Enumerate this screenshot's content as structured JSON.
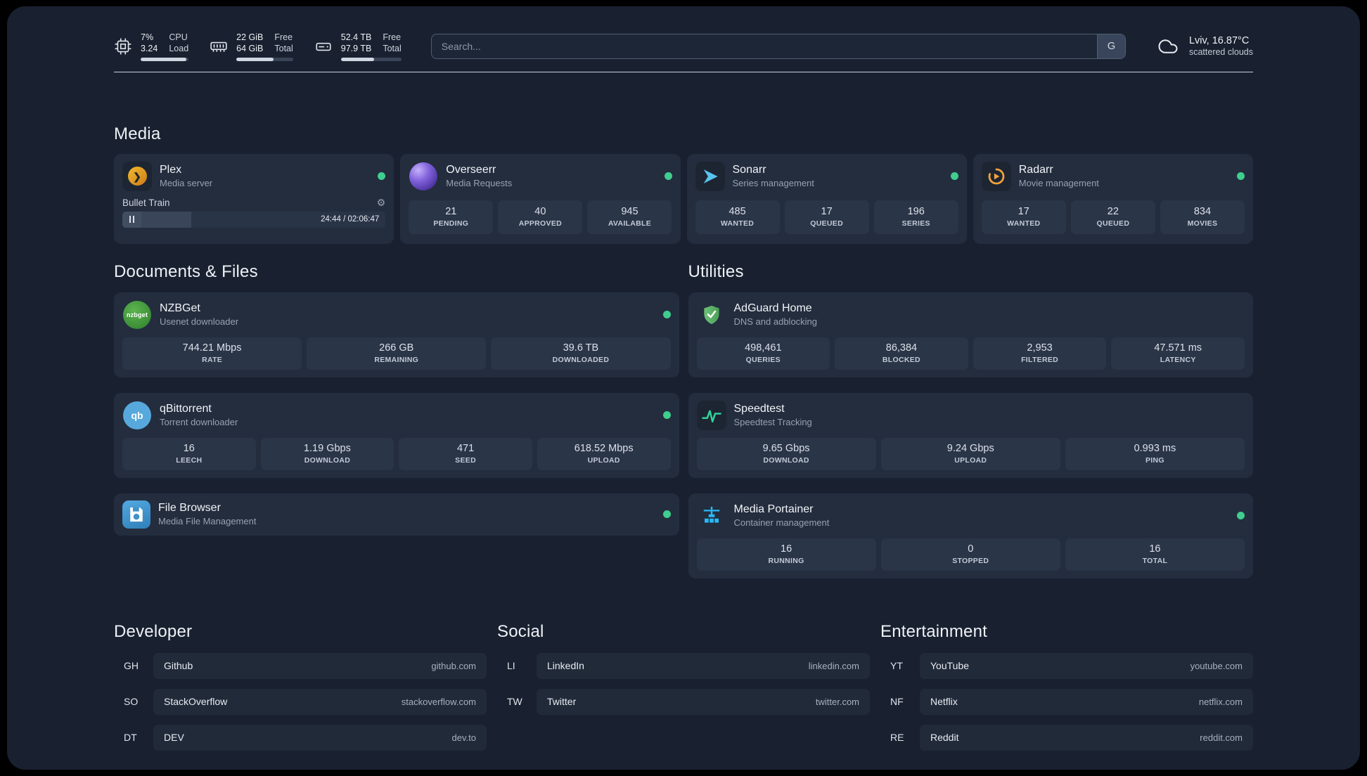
{
  "topbar": {
    "cpu": {
      "value_top": "7%",
      "value_bottom": "3.24",
      "label_top": "CPU",
      "label_bottom": "Load",
      "bar_percent": 95
    },
    "memory": {
      "value_top": "22 GiB",
      "value_bottom": "64 GiB",
      "label_top": "Free",
      "label_bottom": "Total",
      "bar_percent": 66
    },
    "disk": {
      "value_top": "52.4 TB",
      "value_bottom": "97.9 TB",
      "label_top": "Free",
      "label_bottom": "Total",
      "bar_percent": 55
    },
    "search": {
      "placeholder": "Search...",
      "button_label": "G"
    },
    "weather": {
      "location": "Lviv, 16.87°C",
      "condition": "scattered clouds"
    }
  },
  "icons": {
    "gear": "⚙",
    "plex_chevron": "❯",
    "nzbget_label": "nzbget",
    "qbittorrent_label": "qb"
  },
  "colors": {
    "status_online": "#3fce8e",
    "background": "#192130",
    "card": "#232d3e",
    "stat_tile": "#2b3548"
  },
  "groups": {
    "media": {
      "title": "Media",
      "plex": {
        "name": "Plex",
        "description": "Media server",
        "status": "online",
        "now_playing": {
          "title": "Bullet Train",
          "time": "24:44 / 02:06:47",
          "progress_percent": 19
        }
      },
      "overseerr": {
        "name": "Overseerr",
        "description": "Media Requests",
        "status": "online",
        "stats": [
          {
            "value": "21",
            "label": "PENDING"
          },
          {
            "value": "40",
            "label": "APPROVED"
          },
          {
            "value": "945",
            "label": "AVAILABLE"
          }
        ]
      },
      "sonarr": {
        "name": "Sonarr",
        "description": "Series management",
        "status": "online",
        "stats": [
          {
            "value": "485",
            "label": "WANTED"
          },
          {
            "value": "17",
            "label": "QUEUED"
          },
          {
            "value": "196",
            "label": "SERIES"
          }
        ]
      },
      "radarr": {
        "name": "Radarr",
        "description": "Movie management",
        "status": "online",
        "stats": [
          {
            "value": "17",
            "label": "WANTED"
          },
          {
            "value": "22",
            "label": "QUEUED"
          },
          {
            "value": "834",
            "label": "MOVIES"
          }
        ]
      }
    },
    "documents": {
      "title": "Documents & Files",
      "nzbget": {
        "name": "NZBGet",
        "description": "Usenet downloader",
        "status": "online",
        "stats": [
          {
            "value": "744.21 Mbps",
            "label": "RATE"
          },
          {
            "value": "266 GB",
            "label": "REMAINING"
          },
          {
            "value": "39.6 TB",
            "label": "DOWNLOADED"
          }
        ]
      },
      "qbittorrent": {
        "name": "qBittorrent",
        "description": "Torrent downloader",
        "status": "online",
        "stats": [
          {
            "value": "16",
            "label": "LEECH"
          },
          {
            "value": "1.19 Gbps",
            "label": "DOWNLOAD"
          },
          {
            "value": "471",
            "label": "SEED"
          },
          {
            "value": "618.52 Mbps",
            "label": "UPLOAD"
          }
        ]
      },
      "filebrowser": {
        "name": "File Browser",
        "description": "Media File Management",
        "status": "online"
      }
    },
    "utilities": {
      "title": "Utilities",
      "adguard": {
        "name": "AdGuard Home",
        "description": "DNS and adblocking",
        "stats": [
          {
            "value": "498,461",
            "label": "QUERIES"
          },
          {
            "value": "86,384",
            "label": "BLOCKED"
          },
          {
            "value": "2,953",
            "label": "FILTERED"
          },
          {
            "value": "47.571 ms",
            "label": "LATENCY"
          }
        ]
      },
      "speedtest": {
        "name": "Speedtest",
        "description": "Speedtest Tracking",
        "stats": [
          {
            "value": "9.65 Gbps",
            "label": "DOWNLOAD"
          },
          {
            "value": "9.24 Gbps",
            "label": "UPLOAD"
          },
          {
            "value": "0.993 ms",
            "label": "PING"
          }
        ]
      },
      "portainer": {
        "name": "Media Portainer",
        "description": "Container management",
        "status": "online",
        "stats": [
          {
            "value": "16",
            "label": "RUNNING"
          },
          {
            "value": "0",
            "label": "STOPPED"
          },
          {
            "value": "16",
            "label": "TOTAL"
          }
        ]
      }
    },
    "developer": {
      "title": "Developer",
      "bookmarks": [
        {
          "abbr": "GH",
          "name": "Github",
          "domain": "github.com"
        },
        {
          "abbr": "SO",
          "name": "StackOverflow",
          "domain": "stackoverflow.com"
        },
        {
          "abbr": "DT",
          "name": "DEV",
          "domain": "dev.to"
        }
      ]
    },
    "social": {
      "title": "Social",
      "bookmarks": [
        {
          "abbr": "LI",
          "name": "LinkedIn",
          "domain": "linkedin.com"
        },
        {
          "abbr": "TW",
          "name": "Twitter",
          "domain": "twitter.com"
        }
      ]
    },
    "entertainment": {
      "title": "Entertainment",
      "bookmarks": [
        {
          "abbr": "YT",
          "name": "YouTube",
          "domain": "youtube.com"
        },
        {
          "abbr": "NF",
          "name": "Netflix",
          "domain": "netflix.com"
        },
        {
          "abbr": "RE",
          "name": "Reddit",
          "domain": "reddit.com"
        }
      ]
    }
  }
}
